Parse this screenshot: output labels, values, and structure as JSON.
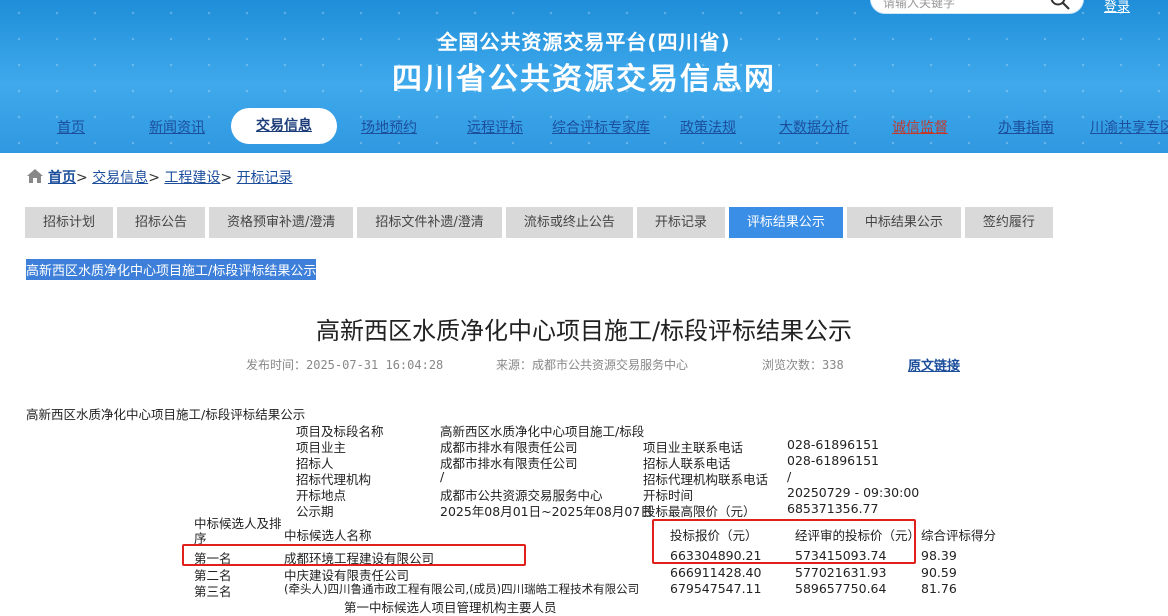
{
  "header": {
    "search_placeholder": "请输入关键字",
    "top_link": "登录",
    "title_small": "全国公共资源交易平台(四川省)",
    "title_big": "四川省公共资源交易信息网"
  },
  "nav": [
    "首页",
    "新闻资讯",
    "交易信息",
    "场地预约",
    "远程评标",
    "综合评标专家库",
    "政策法规",
    "大数据分析",
    "诚信监督",
    "办事指南",
    "川渝共享专区"
  ],
  "breadcrumb": {
    "home": "首页",
    "items": [
      "交易信息",
      "工程建设",
      "开标记录"
    ],
    "sep": ">"
  },
  "tabs": [
    "招标计划",
    "招标公告",
    "资格预审补遗/澄清",
    "招标文件补遗/澄清",
    "流标或终止公告",
    "开标记录",
    "评标结果公示",
    "中标结果公示",
    "签约履行"
  ],
  "selected_heading": "高新西区水质净化中心项目施工/标段评标结果公示",
  "page_title": "高新西区水质净化中心项目施工/标段评标结果公示",
  "meta": {
    "publish": "发布时间：2025-07-31 16:04:28",
    "source": "来源：成都市公共资源交易服务中心",
    "views": "浏览次数：338",
    "original_link": "原文链接"
  },
  "doc": {
    "heading": "高新西区水质净化中心项目施工/标段评标结果公示",
    "info_left": [
      {
        "k": "项目及标段名称",
        "v": "高新西区水质净化中心项目施工/标段"
      },
      {
        "k": "项目业主",
        "v": "成都市排水有限责任公司"
      },
      {
        "k": "招标人",
        "v": "成都市排水有限责任公司"
      },
      {
        "k": "招标代理机构",
        "v": "/"
      },
      {
        "k": "开标地点",
        "v": "成都市公共资源交易服务中心"
      },
      {
        "k": "公示期",
        "v": "2025年08月01日~2025年08月07日"
      }
    ],
    "info_right": [
      {
        "k": "",
        "v": ""
      },
      {
        "k": "项目业主联系电话",
        "v": "028-61896151"
      },
      {
        "k": "招标人联系电话",
        "v": "028-61896151"
      },
      {
        "k": "招标代理机构联系电话",
        "v": "/"
      },
      {
        "k": "开标时间",
        "v": "20250729 - 09:30:00"
      },
      {
        "k": "投标最高限价（元）",
        "v": "685371356.77"
      }
    ],
    "cand_header": {
      "rank": "中标候选人及排序",
      "name": "中标候选人名称",
      "bid": "投标报价（元）",
      "reviewed": "经评审的投标价（元）",
      "score": "综合评标得分"
    },
    "candidates": [
      {
        "rank": "第一名",
        "name": "成都环境工程建设有限公司",
        "bid": "663304890.21",
        "reviewed": "573415093.74",
        "score": "98.39"
      },
      {
        "rank": "第二名",
        "name": "中庆建设有限责任公司",
        "bid": "666911428.40",
        "reviewed": "577021631.93",
        "score": "90.59"
      },
      {
        "rank": "第三名",
        "name": "(牵头人)四川鲁通市政工程有限公司,(成员)四川瑞皓工程技术有限公司",
        "bid": "679547547.11",
        "reviewed": "589657750.64",
        "score": "81.76"
      }
    ],
    "footer_line": "第一中标候选人项目管理机构主要人员"
  },
  "colors": {
    "accent": "#3a8ee6",
    "highlight": "#e0201b"
  }
}
